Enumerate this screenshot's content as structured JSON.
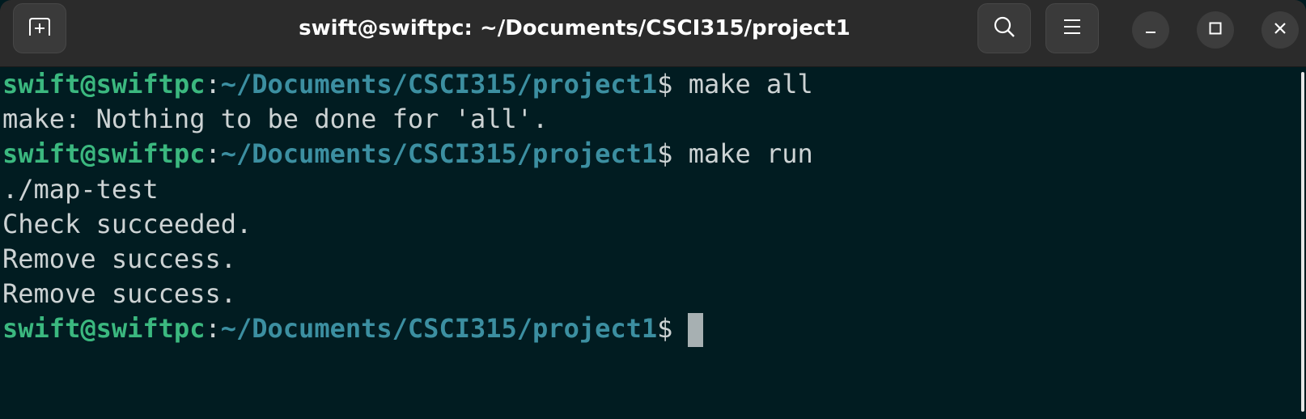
{
  "window": {
    "title": "swift@swiftpc: ~/Documents/CSCI315/project1"
  },
  "icons": {
    "new_tab": "new-tab-icon",
    "search": "search-icon",
    "menu": "hamburger-menu-icon",
    "minimize": "minimize-icon",
    "maximize": "maximize-icon",
    "close": "close-icon"
  },
  "colors": {
    "background": "#011c21",
    "prompt_user": "#3bb87f",
    "prompt_path": "#3c8fa1",
    "text": "#cdd3d4",
    "titlebar": "#2b2b2b"
  },
  "prompt": {
    "user_host": "swift@swiftpc",
    "separator": ":",
    "path": "~/Documents/CSCI315/project1",
    "symbol": "$"
  },
  "terminal": {
    "line1_cmd": " make all",
    "line2": "make: Nothing to be done for 'all'.",
    "line3_cmd": " make run",
    "line4": "./map-test",
    "line5": "Check succeeded.",
    "line6": "Remove success.",
    "line7": "Remove success."
  }
}
